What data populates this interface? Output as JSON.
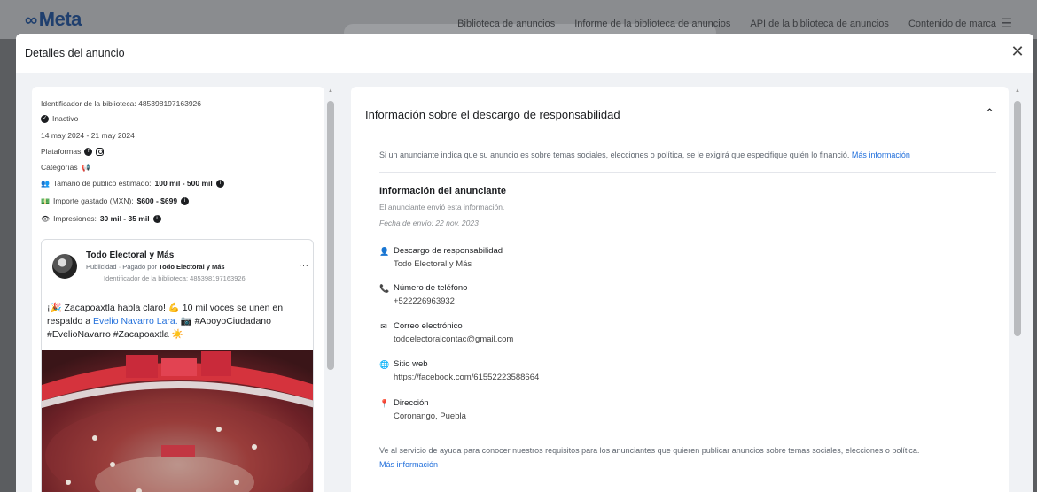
{
  "background": {
    "logo": "Meta",
    "nav": [
      "Biblioteca de anuncios",
      "Informe de la biblioteca de anuncios",
      "API de la biblioteca de anuncios",
      "Contenido de marca"
    ]
  },
  "modal": {
    "title": "Detalles del anuncio",
    "close_icon": "close-icon"
  },
  "ad_meta": {
    "library_id": "Identificador de la biblioteca: 485398197163926",
    "status": "Inactivo",
    "date_range": "14 may 2024 - 21 may 2024",
    "platforms_label": "Plataformas",
    "categories_label": "Categorías",
    "audience_label": "Tamaño de público estimado:",
    "audience_value": "100 mil - 500 mil",
    "spend_label": "Importe gastado (MXN):",
    "spend_value": "$600 - $699",
    "impressions_label": "Impresiones:",
    "impressions_value": "30 mil - 35 mil"
  },
  "ad_card": {
    "page_name": "Todo Electoral y Más",
    "pub_prefix": "Publicidad · Pagado por ",
    "paid_by": "Todo Electoral y Más",
    "library_id": "Identificador de la biblioteca: 485398197163926",
    "more": "···",
    "text_part1": "¡🎉 Zacapoaxtla habla claro! 💪 10 mil voces se unen en respaldo a ",
    "text_link": "Evelio Navarro Lara.",
    "text_part2": " 📷 #ApoyoCiudadano #EvelioNavarro #Zacapoaxtla ☀️"
  },
  "disclaimer_section": {
    "title": "Información sobre el descargo de responsabilidad",
    "intro": "Si un anunciante indica que su anuncio es sobre temas sociales, elecciones o política, se le exigirá que especifique quién lo financió.",
    "intro_link": "Más información",
    "advertiser_title": "Información del anunciante",
    "advertiser_sub": "El anunciante envió esta información.",
    "submit_date": "Fecha de envío: 22 nov. 2023",
    "items": [
      {
        "label": "Descargo de responsabilidad",
        "value": "Todo Electoral y Más"
      },
      {
        "label": "Número de teléfono",
        "value": "+522226963932"
      },
      {
        "label": "Correo electrónico",
        "value": "todoelectoralcontac@gmail.com"
      },
      {
        "label": "Sitio web",
        "value": "https://facebook.com/61552223588664"
      },
      {
        "label": "Dirección",
        "value": "Coronango, Puebla"
      }
    ],
    "help_text": "Ve al servicio de ayuda para conocer nuestros requisitos para los anunciantes que quieren publicar anuncios sobre temas sociales, elecciones o política.",
    "help_link": "Más información"
  }
}
